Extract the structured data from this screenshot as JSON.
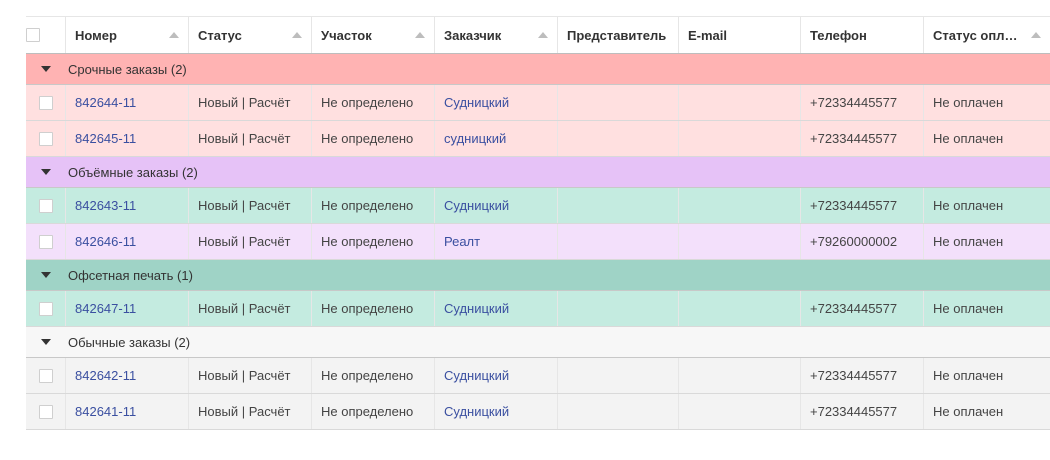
{
  "columns": {
    "number": "Номер",
    "status": "Статус",
    "site": "Участок",
    "customer": "Заказчик",
    "representative": "Представитель",
    "email": "E-mail",
    "phone": "Телефон",
    "payment": "Статус опл…"
  },
  "groups": [
    {
      "title": "Срочные заказы (2)",
      "header_color": "#ffb3b3",
      "rows": [
        {
          "number": "842644-11",
          "status": "Новый | Расчёт",
          "site": "Не определено",
          "customer": "Судницкий",
          "representative": "",
          "email": "",
          "phone": "+72334445577",
          "payment": "Не оплачен",
          "row_color": "#ffe0e0"
        },
        {
          "number": "842645-11",
          "status": "Новый | Расчёт",
          "site": "Не определено",
          "customer": "судницкий",
          "representative": "",
          "email": "",
          "phone": "+72334445577",
          "payment": "Не оплачен",
          "row_color": "#ffe0e0"
        }
      ]
    },
    {
      "title": "Объёмные заказы (2)",
      "header_color": "#e6c2f7",
      "rows": [
        {
          "number": "842643-11",
          "status": "Новый | Расчёт",
          "site": "Не определено",
          "customer": "Судницкий",
          "representative": "",
          "email": "",
          "phone": "+72334445577",
          "payment": "Не оплачен",
          "row_color": "#c4ebe0"
        },
        {
          "number": "842646-11",
          "status": "Новый | Расчёт",
          "site": "Не определено",
          "customer": "Реалт",
          "representative": "",
          "email": "",
          "phone": "+79260000002",
          "payment": "Не оплачен",
          "row_color": "#f3e0fb"
        }
      ]
    },
    {
      "title": "Офсетная печать (1)",
      "header_color": "#9fd3c6",
      "rows": [
        {
          "number": "842647-11",
          "status": "Новый | Расчёт",
          "site": "Не определено",
          "customer": "Судницкий",
          "representative": "",
          "email": "",
          "phone": "+72334445577",
          "payment": "Не оплачен",
          "row_color": "#c4ebe0"
        }
      ]
    },
    {
      "title": "Обычные заказы (2)",
      "header_color": "#f7f7f7",
      "rows": [
        {
          "number": "842642-11",
          "status": "Новый | Расчёт",
          "site": "Не определено",
          "customer": "Судницкий",
          "representative": "",
          "email": "",
          "phone": "+72334445577",
          "payment": "Не оплачен",
          "row_color": "#f3f3f3"
        },
        {
          "number": "842641-11",
          "status": "Новый | Расчёт",
          "site": "Не определено",
          "customer": "Судницкий",
          "representative": "",
          "email": "",
          "phone": "+72334445577",
          "payment": "Не оплачен",
          "row_color": "#f3f3f3"
        }
      ]
    }
  ]
}
